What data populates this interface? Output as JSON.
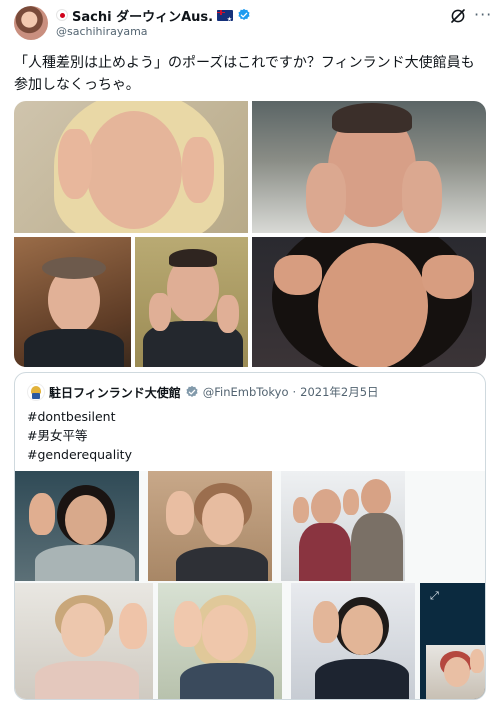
{
  "tweet": {
    "display_name": "Sachi ダーウィンAus.",
    "handle": "@sachihirayama",
    "text": "「人種差別は止めよう」のポーズはこれですか？フィンランド大使館員も参加しなくっちゃ。",
    "icons": [
      "jp-flag-icon",
      "au-flag-icon",
      "verified-badge-icon",
      "grok-icon",
      "more-icon"
    ]
  },
  "quoted_tweet": {
    "display_name": "駐日フィンランド大使館",
    "handle": "@FinEmbTokyo",
    "separator": "·",
    "date": "2021年2月5日",
    "lines": [
      "#dontbesilent",
      "#男女平等",
      "#genderequality"
    ],
    "icons": [
      "embassy-avatar-icon",
      "verified-badge-gray-icon",
      "expand-icon"
    ]
  },
  "colors": {
    "text": "#0f1419",
    "secondary": "#536471",
    "verified_blue": "#1d9bf0",
    "verified_gray": "#829aab",
    "border": "#cfd9de"
  }
}
